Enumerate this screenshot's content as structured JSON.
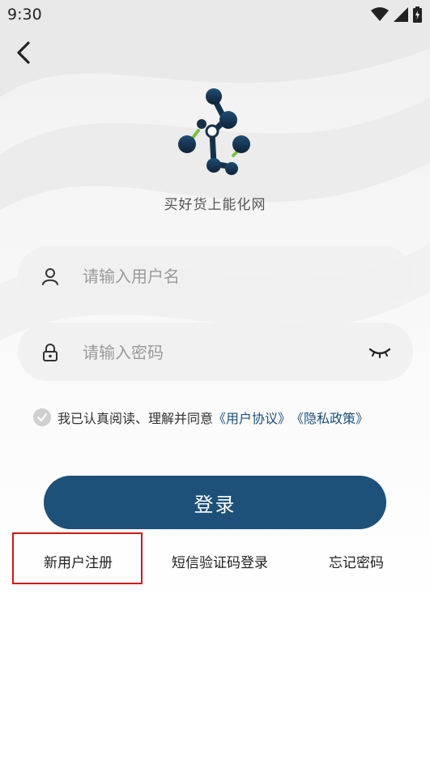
{
  "status_bar": {
    "time": "9:30",
    "icons": [
      "wifi-icon",
      "signal-icon",
      "battery-icon"
    ]
  },
  "header": {
    "back_icon": "chevron-left-icon"
  },
  "brand": {
    "logo_icon": "molecule-logo-icon",
    "app_name": "买好货上能化网"
  },
  "form": {
    "username": {
      "value": "",
      "placeholder": "请输入用户名",
      "icon": "user-icon"
    },
    "password": {
      "value": "",
      "placeholder": "请输入密码",
      "icon": "lock-icon",
      "toggle_icon": "eye-closed-icon"
    }
  },
  "agreement": {
    "checked": false,
    "text": "我已认真阅读、理解并同意",
    "user_agreement": "《用户协议》",
    "privacy_policy": "《隐私政策》"
  },
  "actions": {
    "login_label": "登录",
    "register_label": "新用户注册",
    "sms_login_label": "短信验证码登录",
    "forgot_password_label": "忘记密码"
  },
  "colors": {
    "primary": "#1d5179",
    "link": "#1d4f7a",
    "highlight": "#d01818",
    "accent_green": "#7cc242"
  }
}
